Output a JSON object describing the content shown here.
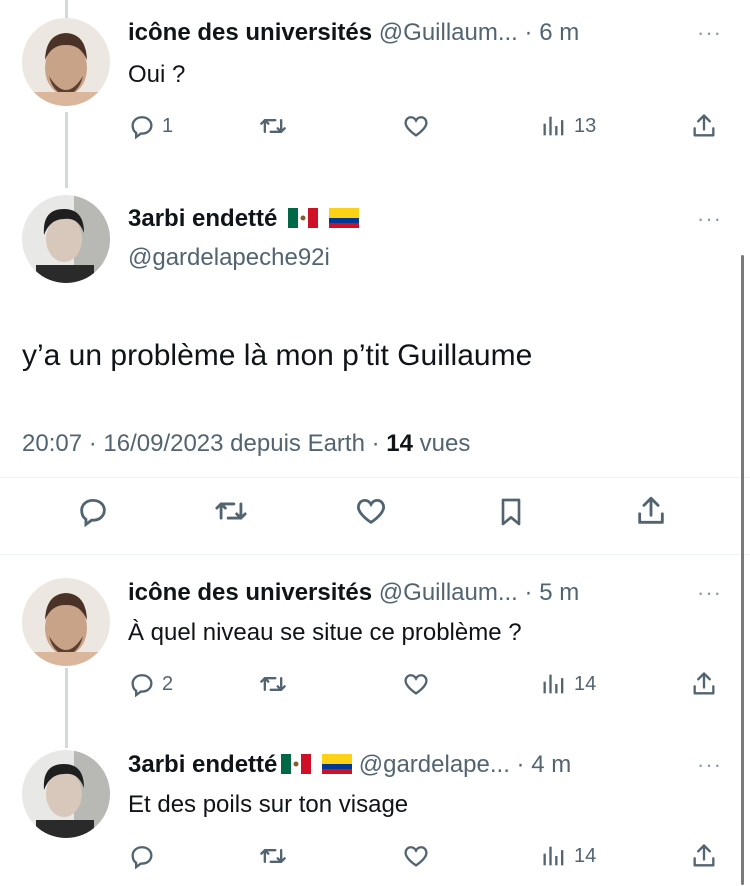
{
  "replies": [
    {
      "name": "icône des universités",
      "handle": "@Guillaum...",
      "time": "· 6 m",
      "text": "Oui ?",
      "replies_count": "1",
      "views": "13"
    },
    {
      "name": "icône des universités",
      "handle": "@Guillaum...",
      "time": "· 5 m",
      "text": "À quel niveau se situe ce problème ?",
      "replies_count": "2",
      "views": "14"
    },
    {
      "name": "3arbi endetté",
      "handle": "@gardelape...",
      "time": "· 4 m",
      "text": "Et des poils sur ton visage",
      "replies_count": "",
      "views": "14"
    }
  ],
  "main_tweet": {
    "name": "3arbi endetté",
    "handle": "@gardelapeche92i",
    "text": "y’a un problème là mon p’tit Guillaume",
    "time": "20:07 · 16/09/2023 depuis Earth ·",
    "views_count": "14",
    "views_label": "vues"
  },
  "more_label": "···",
  "icons": {
    "reply": "reply-icon",
    "retweet": "retweet-icon",
    "like": "heart-icon",
    "views": "views-icon",
    "share": "share-icon",
    "bookmark": "bookmark-icon",
    "flags": [
      "mexico-flag-icon",
      "colombia-flag-icon"
    ]
  },
  "colors": {
    "text": "#0f1419",
    "secondary": "#536471",
    "line": "#cfd9de"
  }
}
